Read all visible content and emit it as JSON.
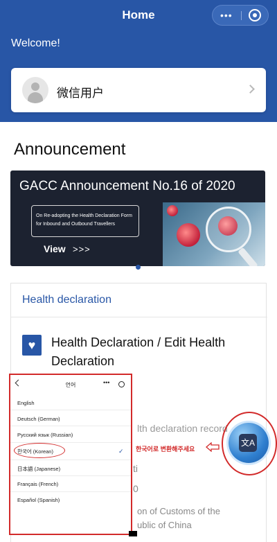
{
  "header": {
    "title": "Home",
    "more_dots": "•••"
  },
  "hero": {
    "welcome": "Welcome!"
  },
  "user_card": {
    "name": "微信用户"
  },
  "announcement": {
    "title": "Announcement",
    "banner": {
      "title": "GACC Announcement No.16 of 2020",
      "box_text": "On Re-adopting the Health Declaration Form for Inbound and Outbound Travellers",
      "view_label": "View",
      "arrows": ">>>"
    }
  },
  "health": {
    "header": "Health declaration",
    "item_title": "Health Declaration / Edit Health Declaration",
    "records_fragment": "lth declaration record",
    "line_ti": "ti",
    "line_num": "0",
    "customs_1": "on of Customs of the",
    "customs_2": "ublic of China"
  },
  "language_panel": {
    "title": "언어",
    "dots": "•••",
    "items": [
      "English",
      "Deutsch (German)",
      "Русский язык (Russian)",
      "한국어 (Korean)",
      "日本語 (Japanese)",
      "Français (French)",
      "Español (Spanish)"
    ],
    "selected_index": 3,
    "check": "✓"
  },
  "annotation": {
    "korean_note": "한국어로 변환해주세요"
  },
  "translate_button": {
    "glyph": "文A"
  }
}
